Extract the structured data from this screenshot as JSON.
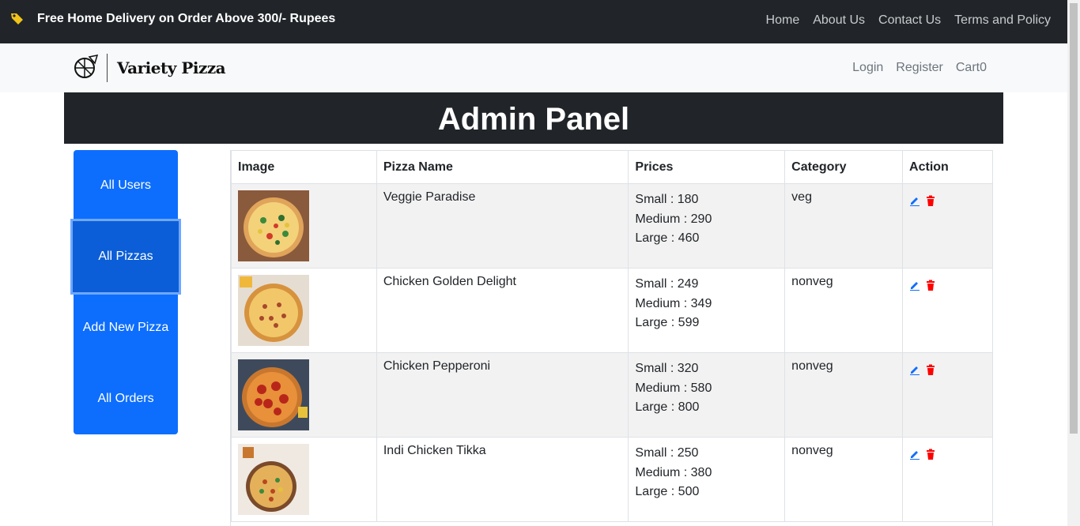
{
  "promo": {
    "text": "Free Home Delivery on Order Above 300/- Rupees",
    "icon": "tag-icon"
  },
  "top_nav": [
    "Home",
    "About Us",
    "Contact Us",
    "Terms and Policy"
  ],
  "brand": {
    "name": "Variety Pizza",
    "icon": "pizza-logo-icon"
  },
  "user_nav": [
    "Login",
    "Register",
    "Cart0"
  ],
  "admin": {
    "title": "Admin Panel"
  },
  "sidebar": {
    "items": [
      "All Users",
      "All Pizzas",
      "Add New Pizza",
      "All Orders"
    ],
    "active": "All Pizzas"
  },
  "table": {
    "headers": [
      "Image",
      "Pizza Name",
      "Prices",
      "Category",
      "Action"
    ],
    "rows": [
      {
        "name": "Veggie Paradise",
        "prices": [
          "Small : 180",
          "Medium : 290",
          "Large : 460"
        ],
        "category": "veg"
      },
      {
        "name": "Chicken Golden Delight",
        "prices": [
          "Small : 249",
          "Medium : 349",
          "Large : 599"
        ],
        "category": "nonveg"
      },
      {
        "name": "Chicken Pepperoni",
        "prices": [
          "Small : 320",
          "Medium : 580",
          "Large : 800"
        ],
        "category": "nonveg"
      },
      {
        "name": "Indi Chicken Tikka",
        "prices": [
          "Small : 250",
          "Medium : 380",
          "Large : 500"
        ],
        "category": "nonveg"
      }
    ]
  },
  "colors": {
    "dark": "#212529",
    "primary": "#0d6efd",
    "danger": "#ff0000"
  }
}
